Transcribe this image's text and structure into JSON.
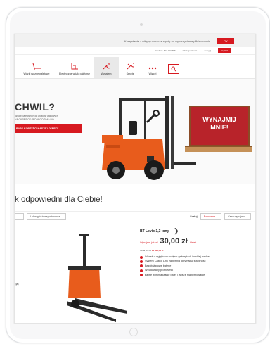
{
  "cookie_bar": {
    "text": "Korzystanie z witryny oznacza zgodę na wykorzystanie plików cookie",
    "ok_label": "OK"
  },
  "info_bar": {
    "phone": "Infolinia: 801 300 555",
    "service": "Obsługa klienta",
    "login": "Zaloguj",
    "cart": "0,00 zł"
  },
  "nav": {
    "items": [
      {
        "label": "Wózki ręczne paletowe",
        "icon": "hand-pallet-truck-icon"
      },
      {
        "label": "Elektryczne wózki paletowe",
        "icon": "electric-pallet-truck-icon"
      },
      {
        "label": "Wynajem",
        "icon": "wrench-icon"
      },
      {
        "label": "Serwis",
        "icon": "tools-icon"
      },
      {
        "label": "Więcej",
        "icon": "more-dots-icon"
      }
    ],
    "search_icon": "search-icon"
  },
  "hero": {
    "title": "CHWIL?",
    "subtitle_line1": "ózków paletowych do wózków widłowych",
    "subtitle_line2": "NA OKRES OD JEDNEGO DNIA DO",
    "cta": "RAPS KORZYŚCI NASZEJ OFERTY",
    "crate_line1": "WYNAJMIJ",
    "crate_line2": "MNIE!"
  },
  "section": {
    "title": "k odpowiedni dla Ciebie!"
  },
  "filters": {
    "filter1": "",
    "filter2": "Udźwig/ół transportowania",
    "sort_label": "Sortuj:",
    "sort_value": "Popularne",
    "sort_order": "Cena wynajmu"
  },
  "product": {
    "left_label": "cja)",
    "name": "BT Levio 1,3 tony",
    "price_from": "Wynajem już od",
    "price_amount": "30,00 zł",
    "price_unit": "/dzień",
    "price_note_prefix": "Cena już od",
    "price_note_value": "14 400,00 zł",
    "features": [
      "Wózek o wyjątkowo małych gabarytach i niskiej wadze",
      "System Castor Link zapewnia optymalną stabilność",
      "Bezobsługowe baterie",
      "Wbudowany prostownik",
      "Łatwe wprowadzanie palet i łapsze manewrowanie"
    ]
  },
  "colors": {
    "accent": "#d71920",
    "forklift_orange": "#e85c1c",
    "text": "#333333"
  }
}
